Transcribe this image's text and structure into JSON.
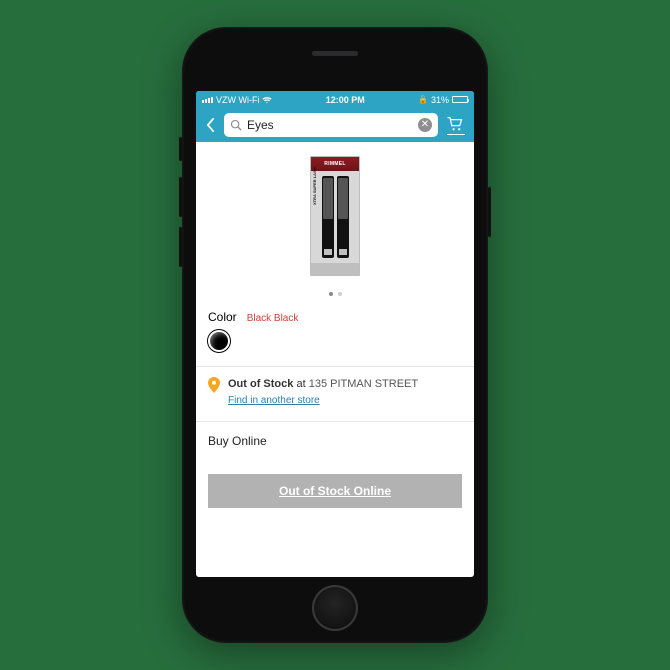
{
  "status": {
    "carrier": "VZW Wi-Fi",
    "time": "12:00 PM",
    "battery_pct": "31%"
  },
  "header": {
    "search_value": "Eyes"
  },
  "product": {
    "package_brand": "RIMMEL",
    "package_label": "XTRA SUPER LASH"
  },
  "color": {
    "label": "Color",
    "value": "Black Black"
  },
  "stock": {
    "status": "Out of Stock",
    "at_word": "at",
    "address": "135 PITMAN STREET",
    "find_link": "Find in another store"
  },
  "buy": {
    "section_label": "Buy Online",
    "button_label": "Out of Stock Online"
  }
}
